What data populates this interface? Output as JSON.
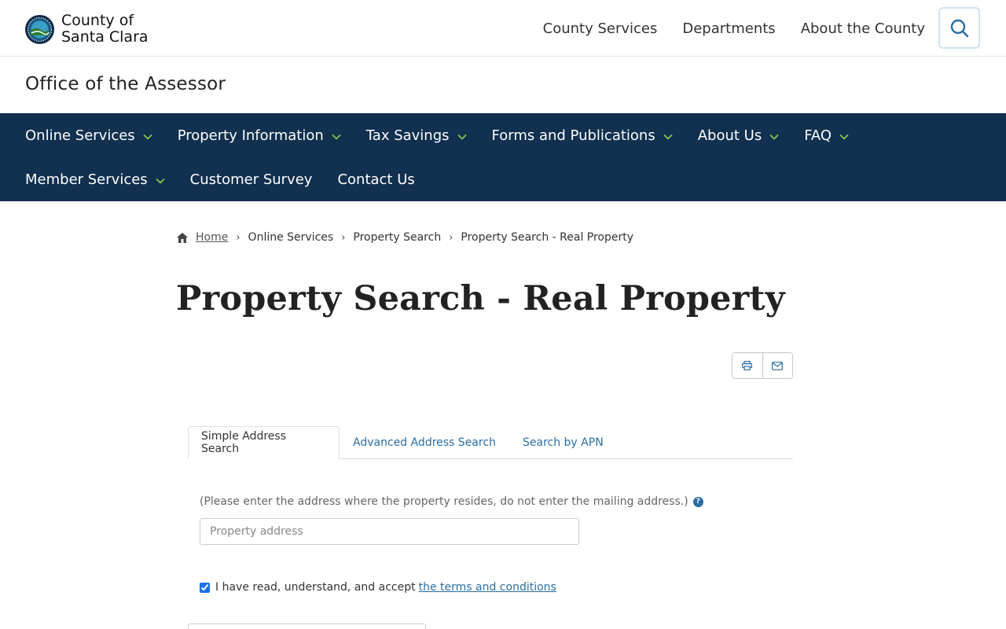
{
  "header": {
    "logo_line1": "County of",
    "logo_line2": "Santa Clara",
    "nav": [
      "County Services",
      "Departments",
      "About the County"
    ],
    "search_icon": "search-icon"
  },
  "office": "Office of the Assessor",
  "main_nav": {
    "row1": [
      {
        "label": "Online Services",
        "dropdown": true
      },
      {
        "label": "Property Information",
        "dropdown": true
      },
      {
        "label": "Tax Savings",
        "dropdown": true
      },
      {
        "label": "Forms and Publications",
        "dropdown": true
      },
      {
        "label": "About Us",
        "dropdown": true
      },
      {
        "label": "FAQ",
        "dropdown": true
      }
    ],
    "row2": [
      {
        "label": "Member Services",
        "dropdown": true
      },
      {
        "label": "Customer Survey",
        "dropdown": false
      },
      {
        "label": "Contact Us",
        "dropdown": false
      }
    ],
    "background": "#12304f",
    "chevron_color": "#8bc34a"
  },
  "breadcrumb": {
    "home": "Home",
    "items": [
      "Online Services",
      "Property Search",
      "Property Search - Real Property"
    ]
  },
  "page_title": "Property Search - Real Property",
  "share": {
    "print_icon": "print-icon",
    "email_icon": "email-icon"
  },
  "tabs": [
    "Simple Address Search",
    "Advanced Address Search",
    "Search by APN"
  ],
  "form": {
    "hint": "(Please enter the address where the property resides, do not enter the mailing address.)",
    "address_placeholder": "Property address",
    "address_value": "",
    "terms_prefix": "I have read, understand, and accept",
    "terms_link": "the terms and conditions",
    "terms_checked": true
  },
  "colors": {
    "link": "#2a6ea3",
    "nav_bg": "#12304f",
    "accent_chevron": "#8bc34a"
  }
}
